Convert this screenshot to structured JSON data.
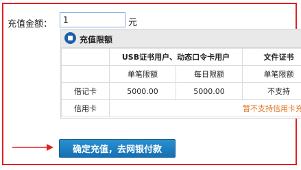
{
  "form": {
    "amount_label": "充值金额：",
    "amount_value": "1",
    "unit": "元"
  },
  "bank": {
    "name": "充值限额",
    "logo_icon": "bank-logo-icon",
    "header_groups": [
      "USB证书用户、动态口令卡用户",
      "文件证书"
    ],
    "subheaders": [
      "单笔限额",
      "每日限额",
      "单笔限额"
    ],
    "rows": [
      {
        "card": "借记卡",
        "cells": [
          "5000.00",
          "5000.00",
          "不支持"
        ]
      },
      {
        "card": "信用卡",
        "notice": "暂不支持信用卡充值"
      }
    ]
  },
  "action": {
    "confirm_label": "确定充值，去网银付款",
    "arrow_icon": "red-arrow-icon"
  },
  "colors": {
    "frame_border": "#e02020",
    "button": "#1a7cc0",
    "notice": "#e0701a"
  }
}
